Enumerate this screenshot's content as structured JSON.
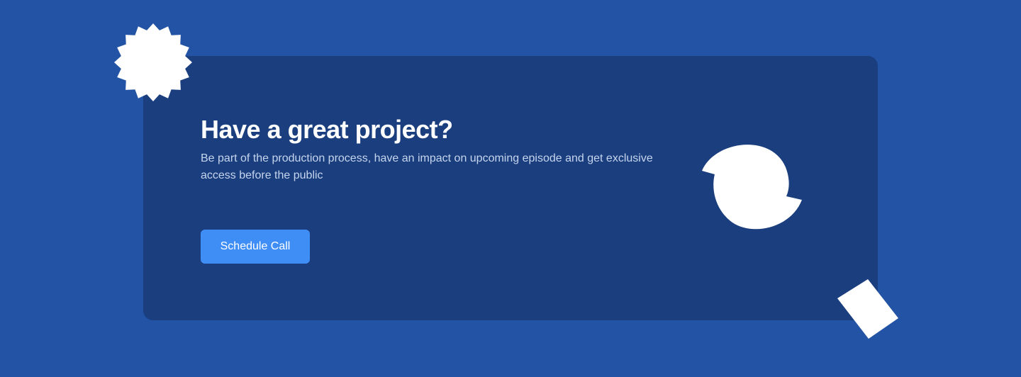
{
  "cta": {
    "title": "Have a great project?",
    "description": "Be part of the production process, have an impact on upcoming episode and get exclusive access before the public",
    "button_label": "Schedule Call"
  },
  "decorations": {
    "badge": "starburst-badge-shape",
    "circle": "notched-circle-shape",
    "square": "rotated-square-shape"
  },
  "colors": {
    "background": "#2353a4",
    "card": "#1a3e7e",
    "button": "#3f8ef5",
    "title": "#ffffff",
    "description": "#c6d5ee",
    "shapes": "#ffffff"
  }
}
